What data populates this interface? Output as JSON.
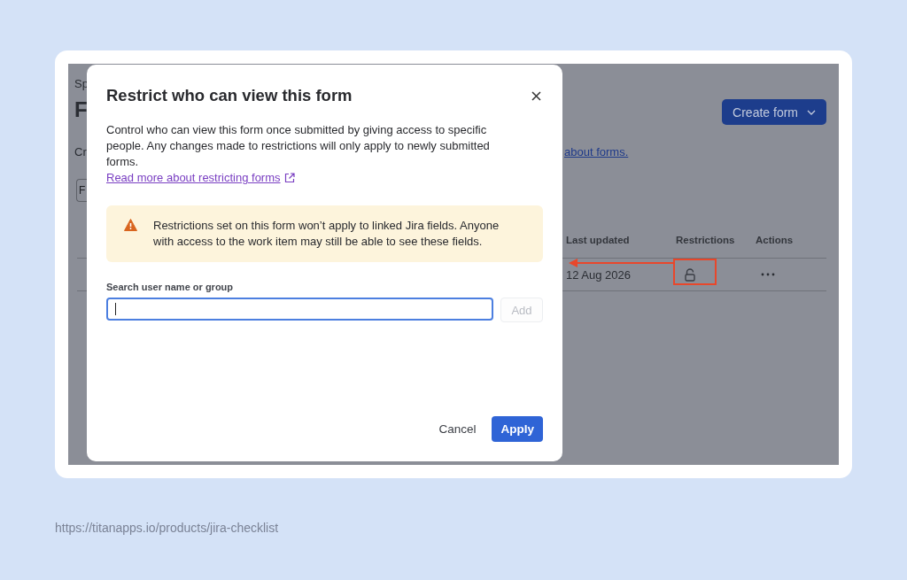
{
  "page_fragments": {
    "breadcrumb": "Sp",
    "heading": "F",
    "description": "Cr",
    "filter_field": "F"
  },
  "create_button": {
    "label": "Create form"
  },
  "intro_link": "about forms.",
  "table": {
    "columns": [
      "Last updated",
      "Restrictions",
      "Actions"
    ],
    "rows": [
      {
        "last_updated": "12 Aug 2026",
        "locked": false
      }
    ]
  },
  "modal": {
    "title": "Restrict who can view this form",
    "description": "Control who can view this form once submitted by giving access to specific people. Any changes made to restrictions will only apply to newly submitted forms.",
    "link": "Read more about restricting forms",
    "warning": "Restrictions set on this form won’t apply to linked Jira fields. Anyone with access to the work item may still be able to see these fields.",
    "search": {
      "label": "Search user name or group",
      "focused": true
    },
    "add_button": {
      "label": "Add",
      "disabled": true
    },
    "cancel_button": {
      "label": "Cancel"
    },
    "apply_button": {
      "label": "Apply"
    }
  },
  "caption": "https://titanapps.io/products/jira-checklist"
}
